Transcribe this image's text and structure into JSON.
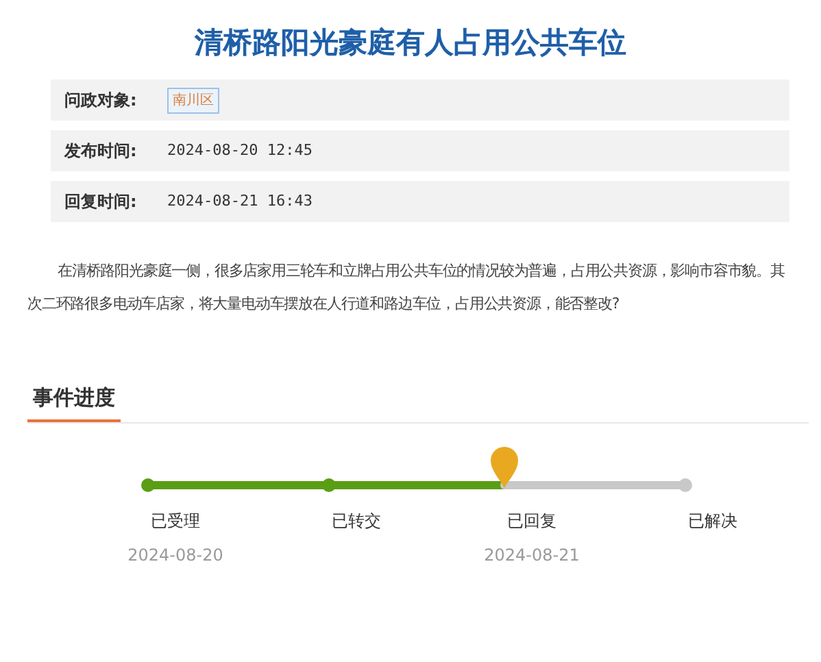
{
  "title": "清桥路阳光豪庭有人占用公共车位",
  "info": [
    {
      "label": "问政对象:",
      "kind": "tag",
      "value": "南川区"
    },
    {
      "label": "发布时间:",
      "kind": "text",
      "value": "2024-08-20 12:45"
    },
    {
      "label": "回复时间:",
      "kind": "text",
      "value": "2024-08-21 16:43"
    }
  ],
  "body": "在清桥路阳光豪庭一侧，很多店家用三轮车和立牌占用公共车位的情况较为普遍，占用公共资源，影响市容市貌。其次二环路很多电动车店家，将大量电动车摆放在人行道和路边车位，占用公共资源，能否整改?",
  "progress": {
    "heading": "事件进度",
    "steps": [
      {
        "label": "已受理",
        "kind": "done",
        "date": "2024-08-20"
      },
      {
        "label": "已转交",
        "kind": "done"
      },
      {
        "label": "已回复",
        "kind": "current",
        "date": "2024-08-21"
      },
      {
        "label": "已解决",
        "kind": "pending"
      }
    ]
  }
}
